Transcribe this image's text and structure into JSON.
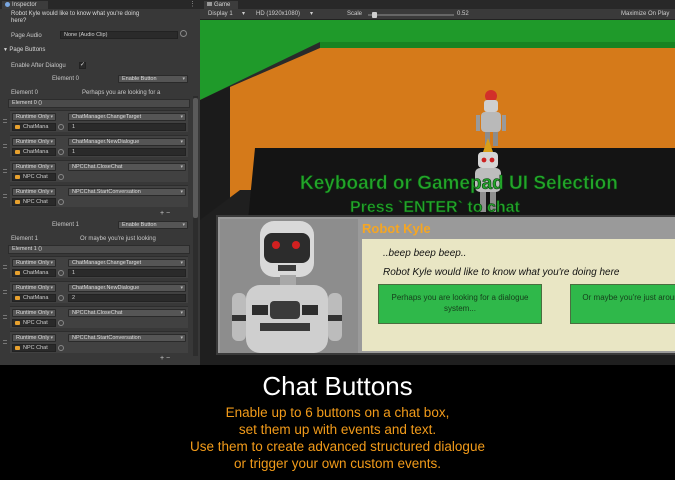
{
  "inspector": {
    "tab_label": "Inspector",
    "message_text_line1": "Robot Kyle would like to know what you're doing",
    "message_text_line2": "here?",
    "page_audio_label": "Page Audio",
    "page_audio_value": "None (Audio Clip)",
    "page_buttons_label": "Page Buttons",
    "enable_after_dialogue_label": "Enable After Dialogu",
    "elements": [
      {
        "header_label": "Element 0",
        "enable_value": "Enable Button",
        "text_label": "Element 0",
        "text_value": "Perhaps you are looking for a",
        "foldout_label": "Element 0 ()",
        "events": [
          {
            "runtime": "Runtime Only",
            "function": "ChatManager.ChangeTarget",
            "object": "ChatMana",
            "arg": "1"
          },
          {
            "runtime": "Runtime Only",
            "function": "ChatManager.NewDialogue",
            "object": "ChatMana",
            "arg": "1"
          },
          {
            "runtime": "Runtime Only",
            "function": "NPCChat.CloseChat",
            "object": "NPC Chat",
            "arg": ""
          },
          {
            "runtime": "Runtime Only",
            "function": "NPCChat.StartConversation",
            "object": "NPC Chat",
            "arg": ""
          }
        ]
      },
      {
        "header_label": "Element 1",
        "enable_value": "Enable Button",
        "text_label": "Element 1",
        "text_value": "Or maybe you're just looking",
        "foldout_label": "Element 1 ()",
        "events": [
          {
            "runtime": "Runtime Only",
            "function": "ChatManager.ChangeTarget",
            "object": "ChatMana",
            "arg": "1"
          },
          {
            "runtime": "Runtime Only",
            "function": "ChatManager.NewDialogue",
            "object": "ChatMana",
            "arg": "2"
          },
          {
            "runtime": "Runtime Only",
            "function": "NPCChat.CloseChat",
            "object": "NPC Chat",
            "arg": ""
          },
          {
            "runtime": "Runtime Only",
            "function": "NPCChat.StartConversation",
            "object": "NPC Chat",
            "arg": ""
          }
        ]
      }
    ]
  },
  "game": {
    "tab_label": "Game",
    "display_label": "Display 1",
    "resolution_label": "HD (1920x1080)",
    "scale_label": "Scale",
    "scale_value": "0.52",
    "scale_level": 0.05,
    "maximize_label": "Maximize On Play",
    "banner_line1": "Keyboard or Gamepad UI Selection",
    "banner_line2": "Press `ENTER` to chat",
    "dialogue": {
      "speaker": "Robot Kyle",
      "line1": "..beep beep beep..",
      "line2": "Robot Kyle would like to know what you're doing here",
      "button1": "Perhaps you are looking for a dialogue system...",
      "button2": "Or maybe you're just around.."
    }
  },
  "caption": {
    "title": "Chat Buttons",
    "lines": [
      "Enable up to 6 buttons on a chat box,",
      "set them up with events and text.",
      "Use them to create advanced structured dialogue",
      "or trigger your own custom events."
    ]
  },
  "colors": {
    "accent_orange": "#f29b1a",
    "button_green": "#2fb84a",
    "banner_green": "#23a52a"
  }
}
